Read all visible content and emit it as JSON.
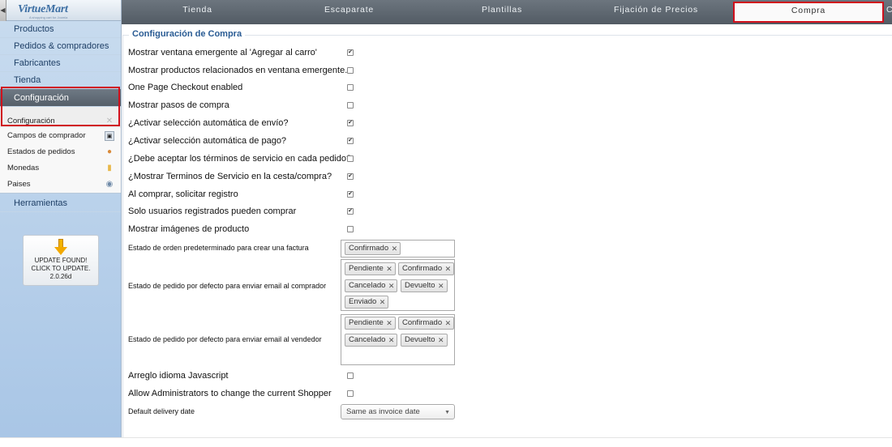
{
  "logo": {
    "text": "VirtueMart",
    "subtext": "A shopping cart for Joomla"
  },
  "sidebar": {
    "items": [
      {
        "label": "Productos"
      },
      {
        "label": "Pedidos & compradores"
      },
      {
        "label": "Fabricantes"
      },
      {
        "label": "Tienda"
      },
      {
        "label": "Configuración"
      }
    ],
    "subitems": [
      {
        "label": "Configuración",
        "icon": "wrench-icon"
      },
      {
        "label": "Campos de comprador",
        "icon": "user-card-icon"
      },
      {
        "label": "Estados de pedidos",
        "icon": "status-icon"
      },
      {
        "label": "Monedas",
        "icon": "coins-icon"
      },
      {
        "label": "Paises",
        "icon": "globe-icon"
      }
    ],
    "tools_label": "Herramientas",
    "update": {
      "line1": "UPDATE FOUND!",
      "line2": "CLICK TO UPDATE.",
      "version": "2.0.26d"
    }
  },
  "tabs": [
    {
      "label": "Tienda"
    },
    {
      "label": "Escaparate"
    },
    {
      "label": "Plantillas"
    },
    {
      "label": "Fijación de Precios"
    },
    {
      "label": "Compra",
      "active": true
    }
  ],
  "tab_more": "C",
  "section": {
    "legend": "Configuración de Compra",
    "options": [
      {
        "label": "Mostrar ventana emergente al 'Agregar al carro'",
        "checked": true
      },
      {
        "label": "Mostrar productos relacionados en ventana emergente.",
        "checked": false
      },
      {
        "label": "One Page Checkout enabled",
        "checked": false
      },
      {
        "label": "Mostrar pasos de compra",
        "checked": false
      },
      {
        "label": "¿Activar selección automática de envío?",
        "checked": true
      },
      {
        "label": "¿Activar selección automática de pago?",
        "checked": true
      },
      {
        "label": "¿Debe aceptar los términos de servicio en cada pedido?",
        "checked": false
      },
      {
        "label": "¿Mostrar Terminos de Servicio en la cesta/compra?",
        "checked": true
      },
      {
        "label": "Al comprar, solicitar registro",
        "checked": true
      },
      {
        "label": "Solo usuarios registrados pueden comprar",
        "checked": true
      },
      {
        "label": "Mostrar imágenes de producto",
        "checked": false
      }
    ],
    "default_order_state": {
      "label": "Estado de orden predeterminado para crear una factura",
      "chips": [
        "Confirmado"
      ]
    },
    "email_shopper": {
      "label": "Estado de pedido por defecto para enviar email al comprador",
      "chips": [
        "Pendiente",
        "Confirmado",
        "Cancelado",
        "Devuelto",
        "Enviado"
      ]
    },
    "email_vendor": {
      "label": "Estado de pedido por defecto para enviar email al vendedor",
      "chips": [
        "Pendiente",
        "Confirmado",
        "Cancelado",
        "Devuelto"
      ]
    },
    "js_lang": {
      "label": "Arreglo idioma Javascript",
      "checked": false
    },
    "admin_shopper": {
      "label": "Allow Administrators to change the current Shopper",
      "checked": false
    },
    "delivery": {
      "label": "Default delivery date",
      "value": "Same as invoice date"
    }
  },
  "colors": {
    "highlight": "#d0101c",
    "legend": "#2a5c94",
    "tab_bar": "#5f6871"
  }
}
